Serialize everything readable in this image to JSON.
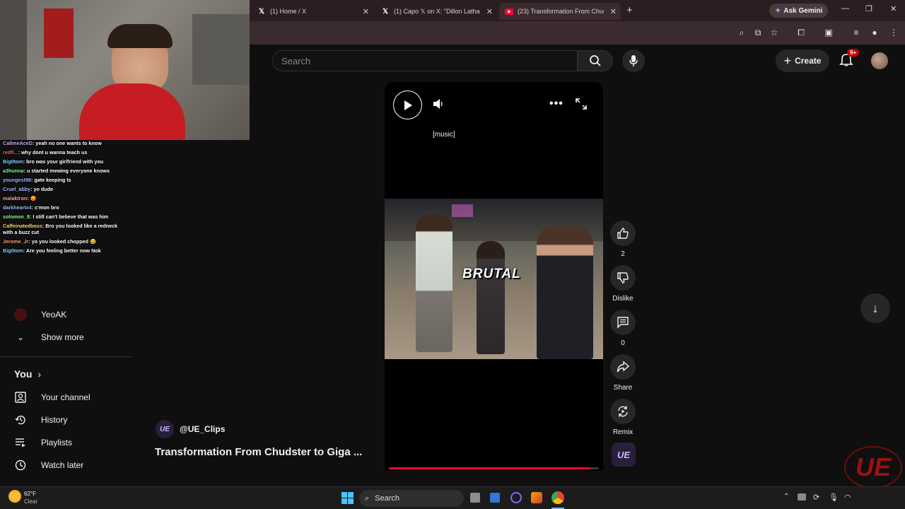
{
  "browser": {
    "tabs": [
      {
        "title": "(1) Home / X",
        "favicon": "x-logo"
      },
      {
        "title": "(1) Capo 𝕏 on X: \"Dillon Latham",
        "favicon": "x-logo"
      },
      {
        "title": "(23) Transformation From Chud",
        "favicon": "youtube-logo",
        "active": true
      }
    ],
    "new_tab_label": "+",
    "ask_gemini_label": "Ask Gemini"
  },
  "youtube": {
    "search_placeholder": "Search",
    "create_label": "Create",
    "notification_count": "9+"
  },
  "sidebar": {
    "subscriptions": [
      {
        "name": "YeoAK"
      }
    ],
    "show_more_label": "Show more",
    "you_heading": "You",
    "you_items": [
      {
        "label": "Your channel",
        "icon": "channel-icon"
      },
      {
        "label": "History",
        "icon": "history-icon"
      },
      {
        "label": "Playlists",
        "icon": "playlist-icon"
      },
      {
        "label": "Watch later",
        "icon": "clock-icon"
      }
    ]
  },
  "short": {
    "caption": "[music]",
    "overlay_text": "BRUTAL",
    "channel_handle": "@UE_Clips",
    "title": "Transformation From Chudster to Giga ...",
    "progress": 0.96,
    "actions": [
      {
        "label": "2",
        "icon": "like-icon"
      },
      {
        "label": "Dislike",
        "icon": "dislike-icon"
      },
      {
        "label": "0",
        "icon": "comment-icon"
      },
      {
        "label": "Share",
        "icon": "share-icon"
      },
      {
        "label": "Remix",
        "icon": "remix-icon"
      }
    ]
  },
  "chat": [
    {
      "user": "CallmeAceD",
      "color": "#c9a7ff",
      "msg": "yeah no one wants to know"
    },
    {
      "user": "redfi...",
      "color": "#ff5a5a",
      "msg": "why dont u wanna teach us"
    },
    {
      "user": "Big0tom",
      "color": "#7fd1ff",
      "msg": "bro was your girlfriend with you"
    },
    {
      "user": "a3hunna",
      "color": "#7dff9a",
      "msg": "u started mewing everyone knows"
    },
    {
      "user": "youngest98",
      "color": "#9fb5ff",
      "msg": "gate keeping ts"
    },
    {
      "user": "Cruel_abby",
      "color": "#9fb5ff",
      "msg": "yo dude"
    },
    {
      "user": "malaktron",
      "color": "#ff9f9f",
      "msg": "😡"
    },
    {
      "user": "darkheartx4",
      "color": "#9fb5ff",
      "msg": "c'mon bro"
    },
    {
      "user": "solomon_8",
      "color": "#7dff9a",
      "msg": "I still can't believe that was him"
    },
    {
      "user": "Caffeinatedboss",
      "color": "#ffd36b",
      "msg": "Bro you looked like a redneck with a buzz cut"
    },
    {
      "user": "Jerome_Jr",
      "color": "#ff9f6b",
      "msg": "yo you looked chopped 😂"
    },
    {
      "user": "Big0tom",
      "color": "#7fd1ff",
      "msg": "Are you feeling better now Nok"
    }
  ],
  "taskbar": {
    "weather_temp": "62°F",
    "weather_cond": "Clear",
    "search_label": "Search"
  },
  "colors": {
    "accent_red": "#ff0033",
    "yt_bg": "#0f0f0f",
    "tab_bg": "#2a1e21"
  }
}
